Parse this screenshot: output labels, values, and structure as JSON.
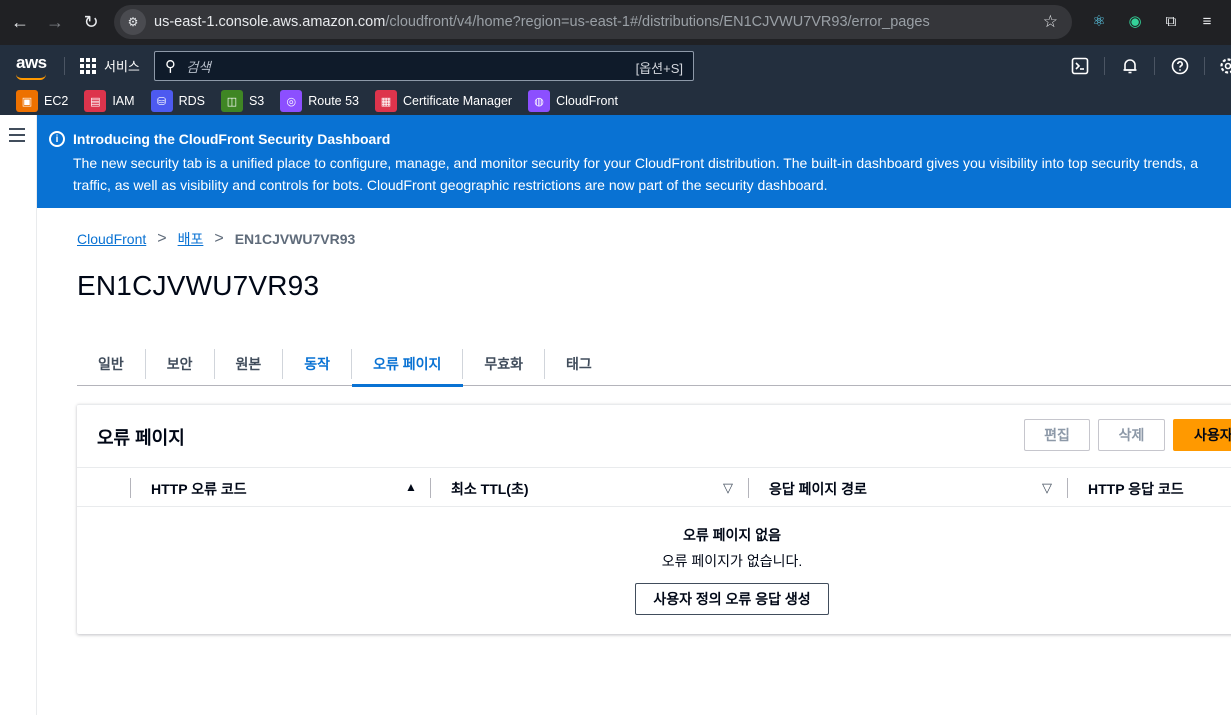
{
  "browser": {
    "url_host": "us-east-1.console.aws.amazon.com",
    "url_path": "/cloudfront/v4/home?region=us-east-1#/distributions/EN1CJVWU7VR93/error_pages"
  },
  "aws_nav": {
    "logo": "aws",
    "services_label": "서비스",
    "search_placeholder": "검색",
    "search_shortcut": "[옵션+S]"
  },
  "favorites": [
    {
      "label": "EC2",
      "color": "#ed7100"
    },
    {
      "label": "IAM",
      "color": "#dd344c"
    },
    {
      "label": "RDS",
      "color": "#4d5af0"
    },
    {
      "label": "S3",
      "color": "#3f8624"
    },
    {
      "label": "Route 53",
      "color": "#8c4fff"
    },
    {
      "label": "Certificate Manager",
      "color": "#dd344c"
    },
    {
      "label": "CloudFront",
      "color": "#8c4fff"
    }
  ],
  "banner": {
    "icon": "i",
    "title": "Introducing the CloudFront Security Dashboard",
    "line1": "The new security tab is a unified place to configure, manage, and monitor security for your CloudFront distribution. The built-in dashboard gives you visibility into top security trends, a",
    "line2": "traffic, as well as visibility and controls for bots. CloudFront geographic restrictions are now part of the security dashboard."
  },
  "breadcrumb": {
    "root": "CloudFront",
    "middle": "배포",
    "current": "EN1CJVWU7VR93"
  },
  "page_title": "EN1CJVWU7VR93",
  "tabs": [
    {
      "label": "일반"
    },
    {
      "label": "보안"
    },
    {
      "label": "원본"
    },
    {
      "label": "동작"
    },
    {
      "label": "오류 페이지"
    },
    {
      "label": "무효화"
    },
    {
      "label": "태그"
    }
  ],
  "panel": {
    "title": "오류 페이지",
    "edit_label": "편집",
    "delete_label": "삭제",
    "create_label": "사용자",
    "columns": [
      {
        "label": "HTTP 오류 코드",
        "sort": "▲"
      },
      {
        "label": "최소 TTL(초)",
        "sort": "▽"
      },
      {
        "label": "응답 페이지 경로",
        "sort": "▽"
      },
      {
        "label": "HTTP 응답 코드",
        "sort": ""
      }
    ],
    "empty_title": "오류 페이지 없음",
    "empty_desc": "오류 페이지가 없습니다.",
    "empty_action": "사용자 정의 오류 응답 생성"
  },
  "colors": {
    "accent": "#0972d3",
    "primary_button": "#ff9900",
    "aws_nav": "#232f3e"
  }
}
